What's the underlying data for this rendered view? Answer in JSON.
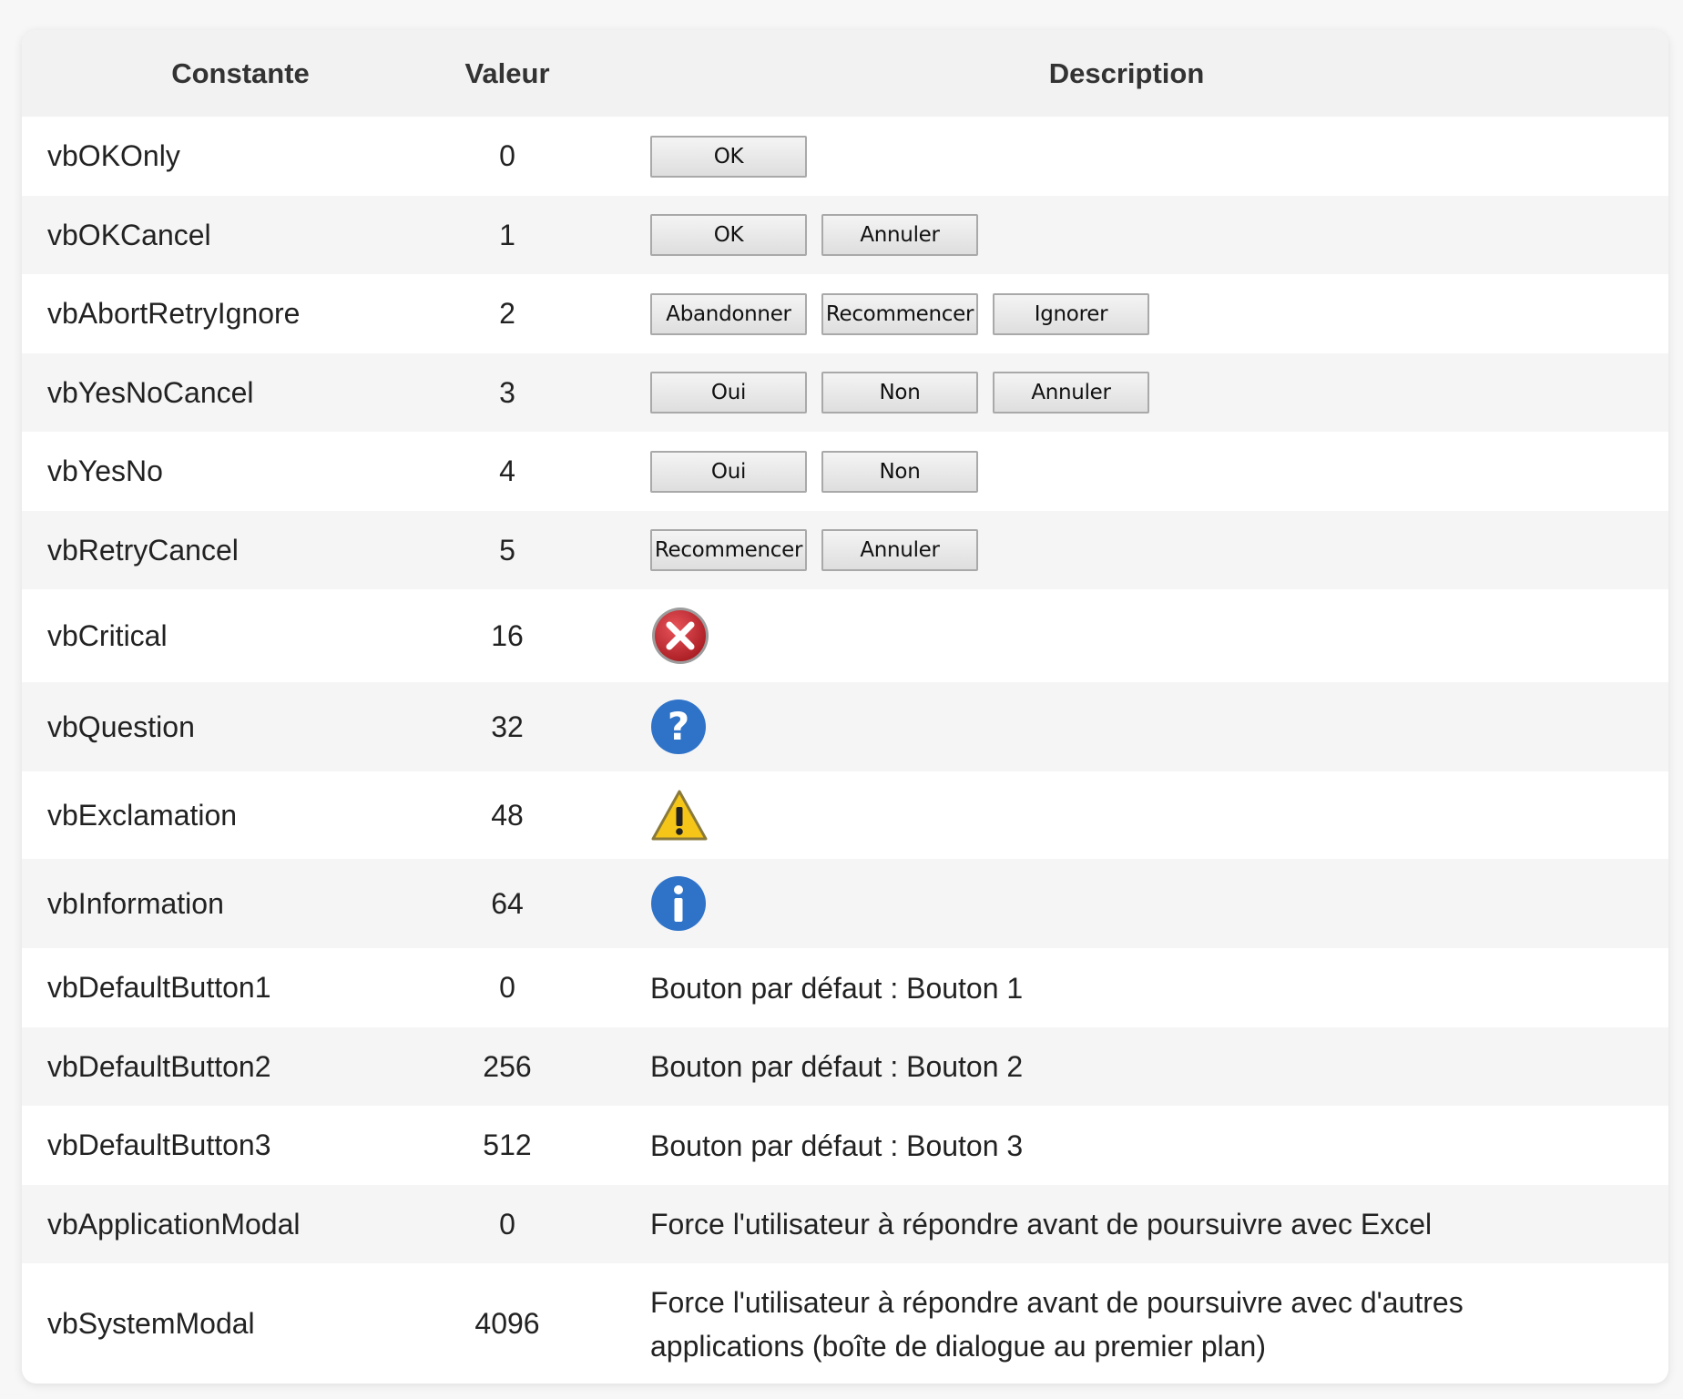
{
  "header": {
    "constant": "Constante",
    "value": "Valeur",
    "description": "Description"
  },
  "rows": [
    {
      "constant": "vbOKOnly",
      "value": "0",
      "buttons": [
        "OK"
      ]
    },
    {
      "constant": "vbOKCancel",
      "value": "1",
      "buttons": [
        "OK",
        "Annuler"
      ]
    },
    {
      "constant": "vbAbortRetryIgnore",
      "value": "2",
      "buttons": [
        "Abandonner",
        "Recommencer",
        "Ignorer"
      ]
    },
    {
      "constant": "vbYesNoCancel",
      "value": "3",
      "buttons": [
        "Oui",
        "Non",
        "Annuler"
      ]
    },
    {
      "constant": "vbYesNo",
      "value": "4",
      "buttons": [
        "Oui",
        "Non"
      ]
    },
    {
      "constant": "vbRetryCancel",
      "value": "5",
      "buttons": [
        "Recommencer",
        "Annuler"
      ]
    },
    {
      "constant": "vbCritical",
      "value": "16",
      "icon": "critical-error-icon"
    },
    {
      "constant": "vbQuestion",
      "value": "32",
      "icon": "question-icon"
    },
    {
      "constant": "vbExclamation",
      "value": "48",
      "icon": "warning-icon"
    },
    {
      "constant": "vbInformation",
      "value": "64",
      "icon": "information-icon"
    },
    {
      "constant": "vbDefaultButton1",
      "value": "0",
      "description": "Bouton par défaut : Bouton 1"
    },
    {
      "constant": "vbDefaultButton2",
      "value": "256",
      "description": "Bouton par défaut : Bouton 2"
    },
    {
      "constant": "vbDefaultButton3",
      "value": "512",
      "description": "Bouton par défaut : Bouton 3"
    },
    {
      "constant": "vbApplicationModal",
      "value": "0",
      "description": "Force l'utilisateur à répondre avant de poursuivre avec Excel"
    },
    {
      "constant": "vbSystemModal",
      "value": "4096",
      "description": "Force l'utilisateur à répondre avant de poursuivre avec d'autres applications (boîte de dialogue au premier plan)"
    }
  ],
  "colors": {
    "critical": "#c0272d",
    "question": "#2f73c9",
    "warning": "#f5c518",
    "information": "#2f73c9"
  }
}
